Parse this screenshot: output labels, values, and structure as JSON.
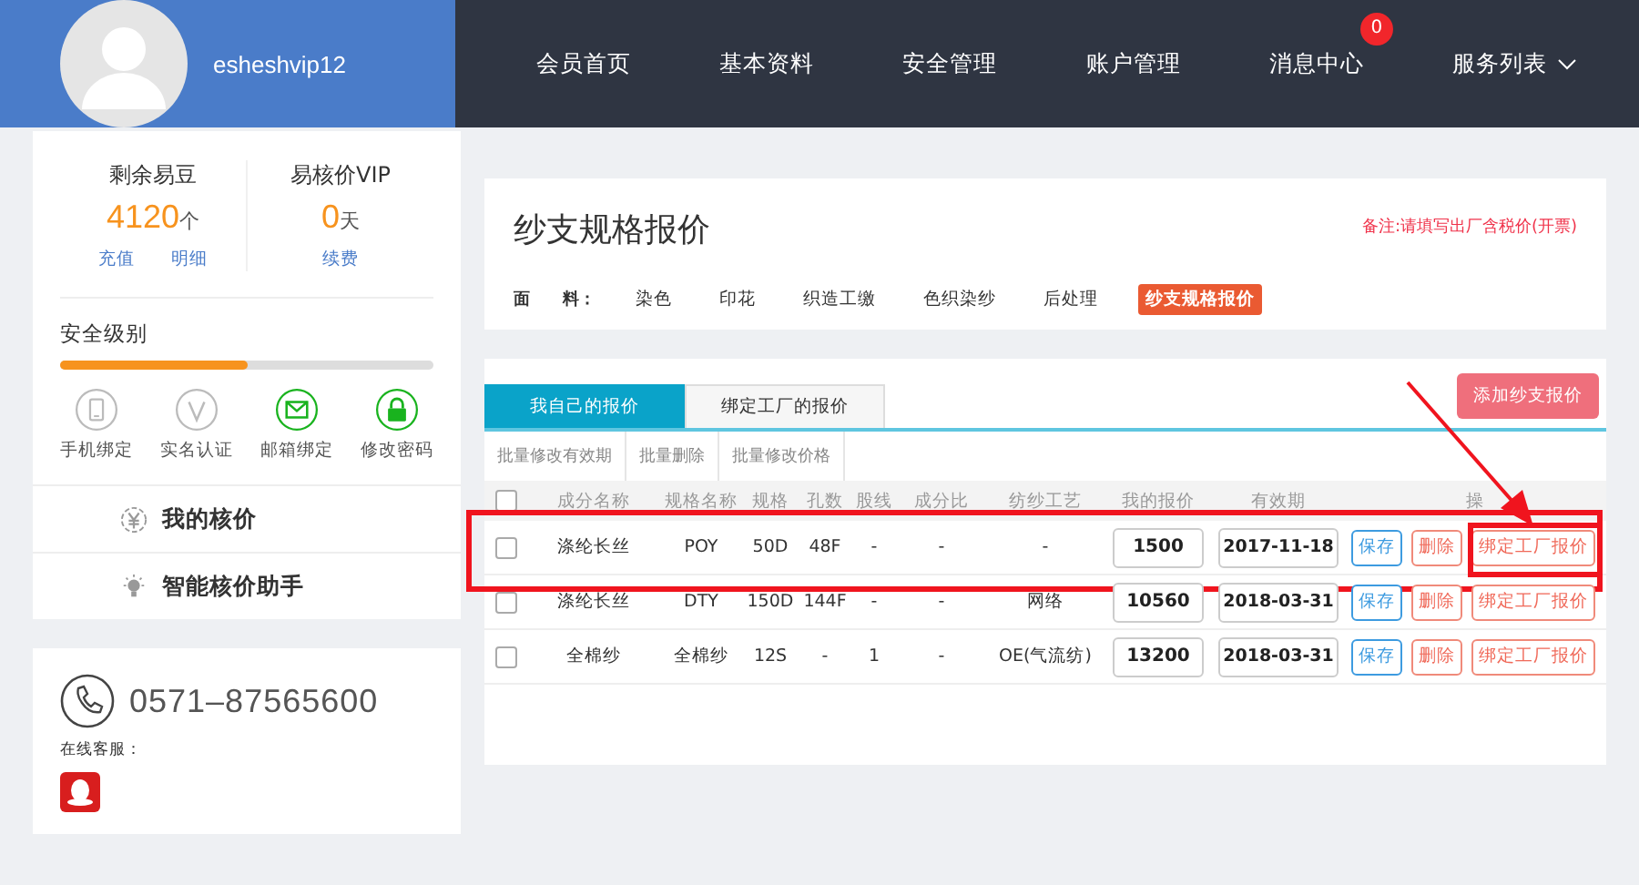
{
  "header": {
    "username": "esheshvip12",
    "nav": [
      {
        "label": "会员首页",
        "kind": "plain"
      },
      {
        "label": "基本资料",
        "kind": "plain"
      },
      {
        "label": "安全管理",
        "kind": "plain"
      },
      {
        "label": "账户管理",
        "kind": "plain"
      },
      {
        "label": "消息中心",
        "kind": "badge",
        "badge": "0"
      },
      {
        "label": "服务列表",
        "kind": "dropdown"
      }
    ]
  },
  "account": [
    {
      "label": "剩余易豆",
      "value": "4120",
      "unit": "个",
      "links": [
        "充值",
        "明细"
      ]
    },
    {
      "label": "易核价VIP",
      "value": "0",
      "unit": "天",
      "links": [
        "续费"
      ]
    }
  ],
  "security": {
    "title": "安全级别",
    "level": 0.5,
    "items": [
      {
        "label": "手机绑定",
        "kind": "phone",
        "bound": false
      },
      {
        "label": "实名认证",
        "kind": "verify",
        "bound": false
      },
      {
        "label": "邮箱绑定",
        "kind": "mail",
        "bound": true
      },
      {
        "label": "修改密码",
        "kind": "lock",
        "bound": true
      }
    ]
  },
  "menu": [
    {
      "label": "我的核价",
      "kind": "yuan"
    },
    {
      "label": "智能核价助手",
      "kind": "bulb"
    }
  ],
  "contact": {
    "phone": "0571–87565600",
    "online_label": "在线客服："
  },
  "page": {
    "title": "纱支规格报价",
    "note": "备注:请填写出厂含税价(开票)",
    "category_label": "面　　料：",
    "categories": [
      {
        "label": "染色",
        "selected": false
      },
      {
        "label": "印花",
        "selected": false
      },
      {
        "label": "织造工缴",
        "selected": false
      },
      {
        "label": "色织染纱",
        "selected": false
      },
      {
        "label": "后处理",
        "selected": false
      },
      {
        "label": "纱支规格报价",
        "selected": true
      }
    ]
  },
  "quotes": {
    "tabs": [
      {
        "label": "我自己的报价",
        "selected": true
      },
      {
        "label": "绑定工厂的报价",
        "selected": false
      }
    ],
    "add_button": "添加纱支报价",
    "select_all_checked": false,
    "batch": [
      "批量修改有效期",
      "批量删除",
      "批量修改价格"
    ],
    "columns": [
      "成分名称",
      "规格名称",
      "规格",
      "孔数",
      "股线",
      "成分比",
      "纺纱工艺",
      "我的报价",
      "有效期",
      "操"
    ],
    "rows": [
      {
        "checked": false,
        "highlighted": true,
        "cells": [
          "涤纶长丝",
          "POY",
          "50D",
          "48F",
          "-",
          "-",
          "-"
        ],
        "price": "1500",
        "expiry": "2017-11-18",
        "actions": [
          "保存",
          "删除",
          "绑定工厂报价"
        ]
      },
      {
        "checked": false,
        "highlighted": false,
        "cells": [
          "涤纶长丝",
          "DTY",
          "150D",
          "144F",
          "-",
          "-",
          "网络"
        ],
        "price": "10560",
        "expiry": "2018-03-31",
        "actions": [
          "保存",
          "删除",
          "绑定工厂报价"
        ]
      },
      {
        "checked": false,
        "highlighted": false,
        "cells": [
          "全棉纱",
          "全棉纱",
          "12S",
          "-",
          "1",
          "-",
          "OE(气流纺)"
        ],
        "price": "13200",
        "expiry": "2018-03-31",
        "actions": [
          "保存",
          "删除",
          "绑定工厂报价"
        ]
      }
    ]
  }
}
